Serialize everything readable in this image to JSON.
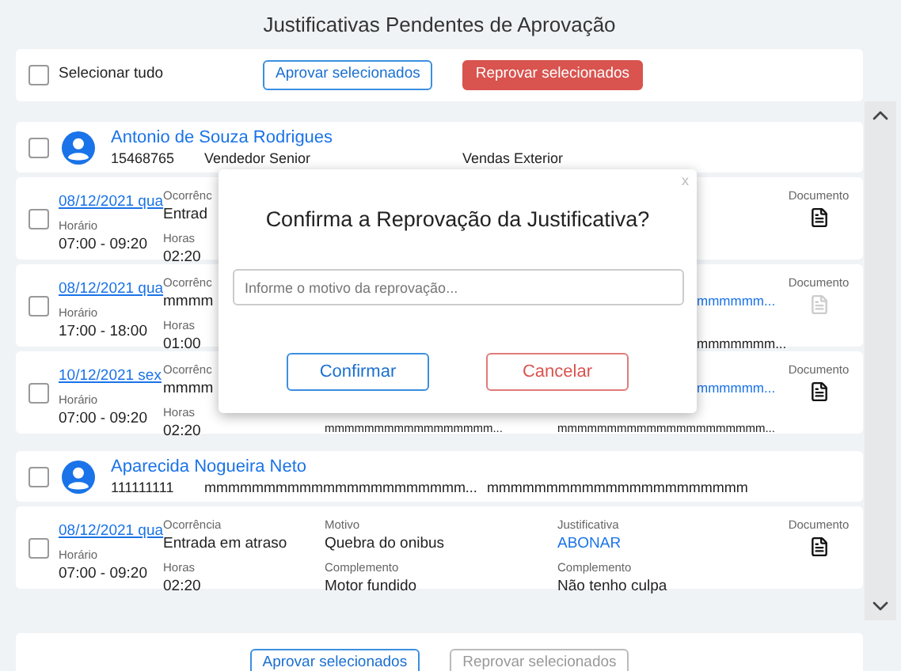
{
  "title": "Justificativas Pendentes de Aprovação",
  "top_bar": {
    "select_all": {
      "label": "Selecionar tudo",
      "checked": false
    },
    "buttons": [
      {
        "label": "Aprovar selecionados",
        "kind": "approve",
        "disabled": false
      },
      {
        "label": "Reprovar selecionados",
        "kind": "reject",
        "disabled": false
      }
    ]
  },
  "employees": [
    {
      "name": "Antonio de Souza Rodrigues",
      "checked": false,
      "id": "15468765",
      "role": "Vendedor Senior",
      "department": "Vendas Exterior",
      "entries": [
        {
          "kind": "covered",
          "checked": false,
          "date": "08/12/2021 qua",
          "schedule_label": "Horário",
          "schedule": "07:00 - 09:20",
          "occurrence_label": "Ocorrênc",
          "occurrence": "Entrad",
          "hours_label": "Horas",
          "hours": "02:20",
          "document_label": "Documento",
          "document_available": true
        },
        {
          "kind": "covered",
          "checked": false,
          "date": "08/12/2021 qua",
          "schedule_label": "Horário",
          "schedule": "17:00 - 18:00",
          "occurrence_label": "Ocorrênc",
          "occurrence": "mmmm",
          "hours_label": "Horas",
          "hours": "01:00",
          "justification_tail": "mmmmmm...",
          "complement_tail": "mmmmmmm...",
          "document_label": "Documento",
          "document_available": false
        },
        {
          "kind": "covered",
          "checked": false,
          "date": "10/12/2021 sex",
          "schedule_label": "Horário",
          "schedule": "07:00 - 09:20",
          "occurrence_label": "Ocorrênc",
          "occurrence": "mmmm",
          "hours_label": "Horas",
          "hours": "02:20",
          "justification_tail": "mmmmmm...",
          "reason_complement": "mmmmmmmmmmmmmmmmm...",
          "justification_complement": "mmmmmmmmmmmmmmmmmmmmm...",
          "document_label": "Documento",
          "document_available": true
        }
      ]
    },
    {
      "name": "Aparecida Nogueira Neto",
      "checked": false,
      "id": "111111111",
      "role": "mmmmmmmmmmmmmmmmmmmmmm...",
      "department": "mmmmmmmmmmmmmmmmmmmmmm",
      "entries": [
        {
          "kind": "full",
          "checked": false,
          "date": "08/12/2021 qua",
          "schedule_label": "Horário",
          "schedule": "07:00 - 09:20",
          "occurrence_label": "Ocorrência",
          "occurrence": "Entrada em atraso",
          "hours_label": "Horas",
          "hours": "02:20",
          "reason_label": "Motivo",
          "reason": "Quebra do onibus",
          "reason_complement_label": "Complemento",
          "reason_complement": "Motor fundido",
          "justification_label": "Justificativa",
          "justification": "ABONAR",
          "justification_complement_label": "Complemento",
          "justification_complement": "Não tenho culpa",
          "document_label": "Documento",
          "document_available": true
        }
      ]
    }
  ],
  "bottom_bar": {
    "buttons": [
      {
        "label": "Aprovar selecionados",
        "kind": "approve",
        "disabled": false
      },
      {
        "label": "Reprovar selecionados",
        "kind": "reject",
        "disabled": true
      }
    ]
  },
  "dialog": {
    "title": "Confirma a Reprovação da Justificativa?",
    "close": "x",
    "reason_field": {
      "placeholder": "Informe o motivo da reprovação..."
    },
    "buttons": [
      {
        "label": "Confirmar",
        "kind": "confirm"
      },
      {
        "label": "Cancelar",
        "kind": "cancel"
      }
    ]
  }
}
